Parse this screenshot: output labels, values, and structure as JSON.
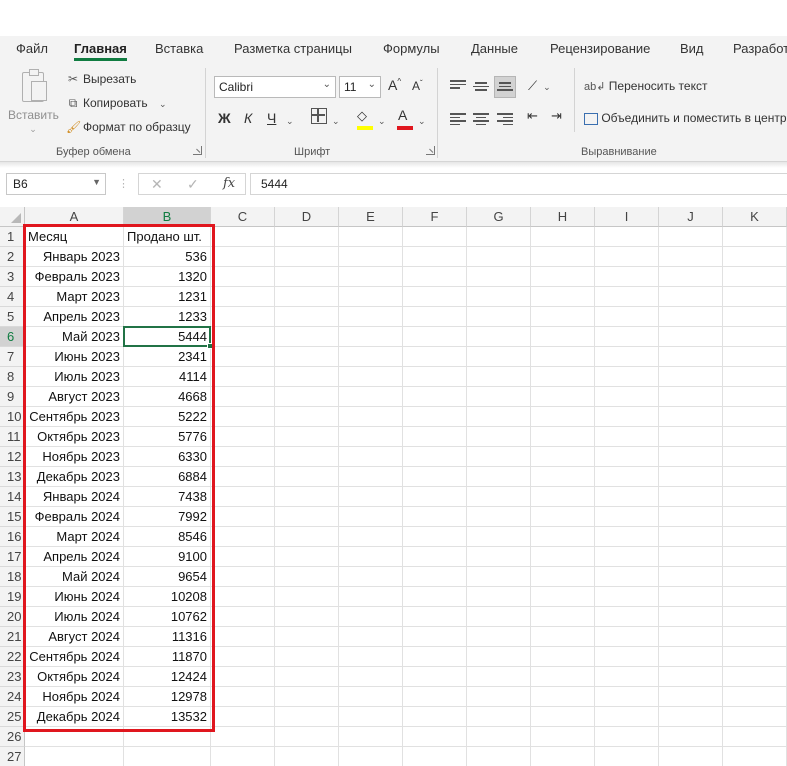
{
  "ribbon": {
    "tabs": [
      "Файл",
      "Главная",
      "Вставка",
      "Разметка страницы",
      "Формулы",
      "Данные",
      "Рецензирование",
      "Вид",
      "Разработ"
    ],
    "active_tab": "Главная",
    "clipboard": {
      "paste": "Вставить",
      "cut": "Вырезать",
      "copy": "Копировать",
      "format_painter": "Формат по образцу",
      "label": "Буфер обмена"
    },
    "font": {
      "name": "Calibri",
      "size": "11",
      "bold": "Ж",
      "italic": "К",
      "underline": "Ч",
      "grow": "A",
      "shrink": "A",
      "color_letter": "A",
      "label": "Шрифт"
    },
    "alignment": {
      "wrap_text": "Переносить текст",
      "merge_center": "Объединить и поместить в центре",
      "label": "Выравнивание"
    }
  },
  "formula_bar": {
    "name_box": "B6",
    "fx": "fx",
    "value": "5444"
  },
  "sheet": {
    "columns": [
      "A",
      "B",
      "C",
      "D",
      "E",
      "F",
      "G",
      "H",
      "I",
      "J",
      "K"
    ],
    "rows": [
      "1",
      "2",
      "3",
      "4",
      "5",
      "6",
      "7",
      "8",
      "9",
      "10",
      "11",
      "12",
      "13",
      "14",
      "15",
      "16",
      "17",
      "18",
      "19",
      "20",
      "21",
      "22",
      "23",
      "24",
      "25",
      "26",
      "27"
    ],
    "header": {
      "a": "Месяц",
      "b": "Продано шт."
    },
    "data": [
      {
        "month": "Январь 2023",
        "sold": "536"
      },
      {
        "month": "Февраль 2023",
        "sold": "1320"
      },
      {
        "month": "Март 2023",
        "sold": "1231"
      },
      {
        "month": "Апрель 2023",
        "sold": "1233"
      },
      {
        "month": "Май 2023",
        "sold": "5444"
      },
      {
        "month": "Июнь 2023",
        "sold": "2341"
      },
      {
        "month": "Июль 2023",
        "sold": "4114"
      },
      {
        "month": "Август 2023",
        "sold": "4668"
      },
      {
        "month": "Сентябрь 2023",
        "sold": "5222"
      },
      {
        "month": "Октябрь 2023",
        "sold": "5776"
      },
      {
        "month": "Ноябрь 2023",
        "sold": "6330"
      },
      {
        "month": "Декабрь 2023",
        "sold": "6884"
      },
      {
        "month": "Январь 2024",
        "sold": "7438"
      },
      {
        "month": "Февраль 2024",
        "sold": "7992"
      },
      {
        "month": "Март 2024",
        "sold": "8546"
      },
      {
        "month": "Апрель 2024",
        "sold": "9100"
      },
      {
        "month": "Май 2024",
        "sold": "9654"
      },
      {
        "month": "Июнь 2024",
        "sold": "10208"
      },
      {
        "month": "Июль 2024",
        "sold": "10762"
      },
      {
        "month": "Август 2024",
        "sold": "11316"
      },
      {
        "month": "Сентябрь 2024",
        "sold": "11870"
      },
      {
        "month": "Октябрь 2024",
        "sold": "12424"
      },
      {
        "month": "Ноябрь 2024",
        "sold": "12978"
      },
      {
        "month": "Декабрь 2024",
        "sold": "13532"
      }
    ],
    "active_cell": "B6",
    "accent_color": "#217346",
    "highlight_color": "#e0161e"
  }
}
